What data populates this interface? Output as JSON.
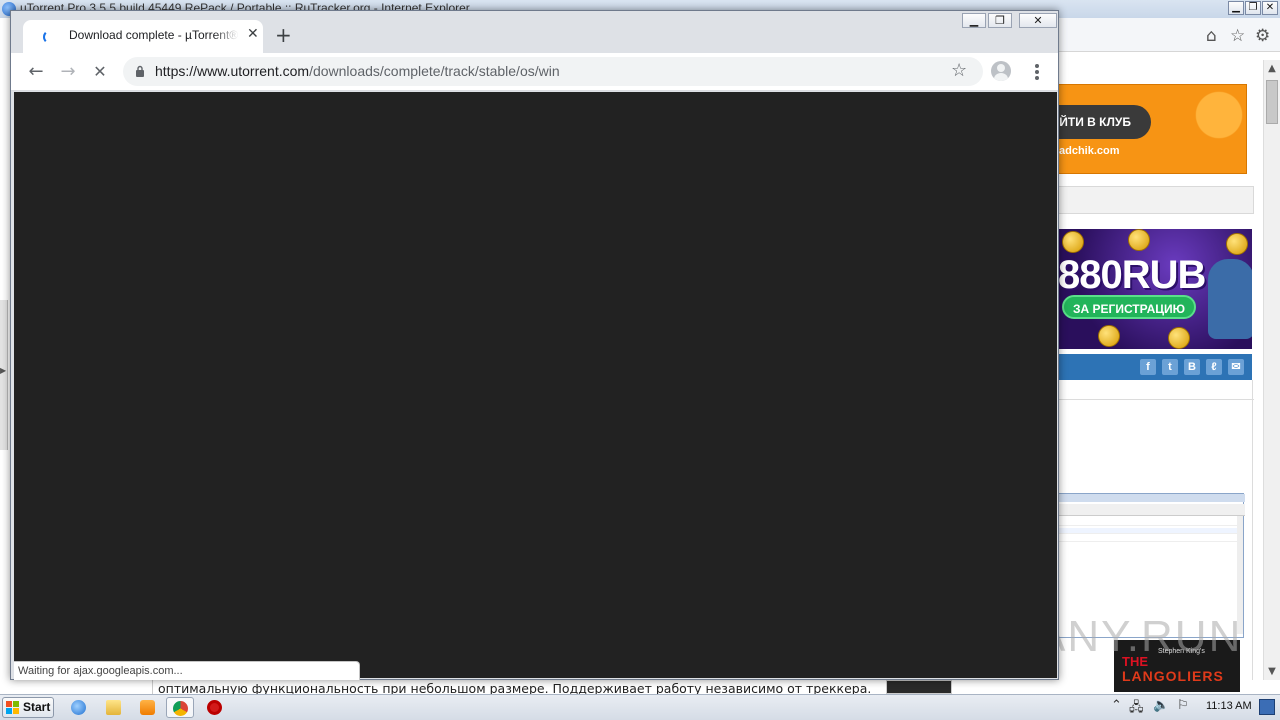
{
  "ie": {
    "title": "uTorrent Pro 3.5.5 build 45449 RePack / Portable :: RuTracker.org - Internet Explorer",
    "ad_club_label": "ЙТИ В КЛУБ",
    "ad_domain": "adchik.com",
    "ad_casino_amount": "880RUB",
    "ad_casino_cta": "ЗА РЕГИСТРАЦИЮ",
    "social": [
      "f",
      "t",
      "B",
      "ℓ",
      "✉"
    ],
    "poster_tag": "Stephen King's",
    "poster_title": "THE",
    "poster_title2": "LANGOLIERS",
    "page_text": "оптимальную функциональность при небольшом размере. Поддерживает работу независимо от треккера.",
    "watermark": "ANY.RUN"
  },
  "chrome": {
    "tab_title": "Download complete - µTorrent® (uTorrent)",
    "url_host": "https://www.utorrent.com",
    "url_path": "/downloads/complete/track/stable/os/win",
    "status_text": "Waiting for ajax.googleapis.com..."
  },
  "taskbar": {
    "start_label": "Start",
    "clock": "11:13 AM"
  },
  "colors": {
    "chrome_frame": "#dee1e6",
    "content_bg": "#222222",
    "link_blue": "#1a73e8",
    "ad_orange": "#f79414",
    "social_blue": "#2d73b5"
  },
  "icons": {
    "back": "arrow-left-icon",
    "forward": "arrow-right-icon",
    "stop": "close-icon",
    "lock": "lock-icon",
    "bookmark": "star-icon",
    "profile": "profile-icon",
    "menu": "kebab-menu-icon"
  }
}
